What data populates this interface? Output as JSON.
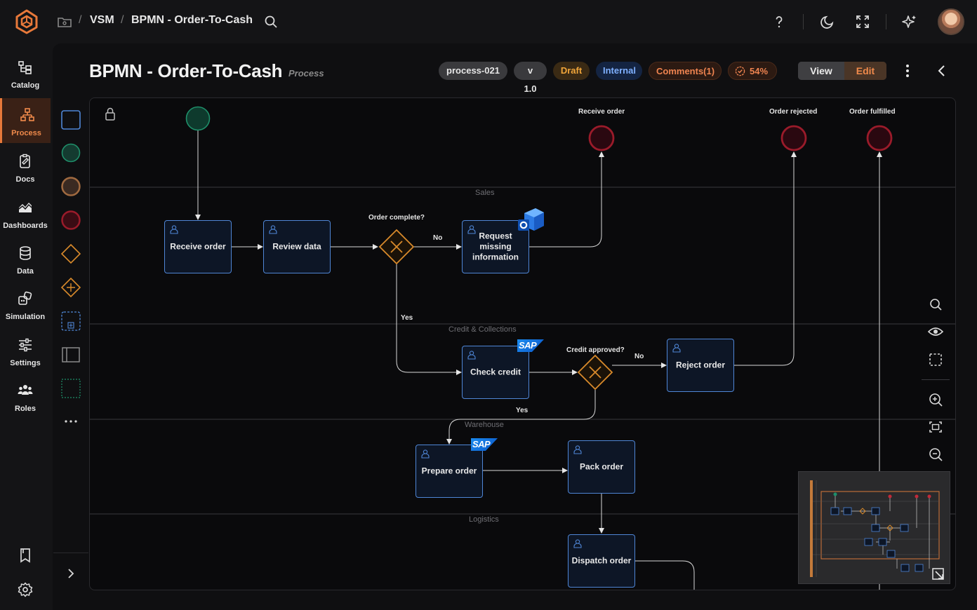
{
  "breadcrumb": {
    "root": "VSM",
    "current": "BPMN - Order-To-Cash"
  },
  "nav": [
    {
      "label": "Catalog",
      "icon": "catalog-icon"
    },
    {
      "label": "Process",
      "icon": "process-icon",
      "active": true
    },
    {
      "label": "Docs",
      "icon": "docs-icon"
    },
    {
      "label": "Dashboards",
      "icon": "dashboards-icon"
    },
    {
      "label": "Data",
      "icon": "data-icon"
    },
    {
      "label": "Simulation",
      "icon": "simulation-icon"
    },
    {
      "label": "Settings",
      "icon": "settings-icon"
    },
    {
      "label": "Roles",
      "icon": "roles-icon"
    }
  ],
  "header": {
    "title": "BPMN - Order-To-Cash",
    "subtitle": "Process",
    "process_id": "process-021",
    "version": "v 1.0",
    "status": "Draft",
    "visibility": "Internal",
    "comments": "Comments(1)",
    "progress": "54%",
    "view_label": "View",
    "edit_label": "Edit"
  },
  "colors": {
    "accent": "#e8793a",
    "task_border": "#4f86d6",
    "gateway": "#d98a2b",
    "end_event": "#9a1b2a",
    "start_event": "#1f8f6a"
  },
  "diagram": {
    "lanes": [
      "Sales",
      "Credit & Collections",
      "Warehouse",
      "Logistics"
    ],
    "end_events": [
      "Receive order",
      "Order rejected",
      "Order fulfilled"
    ],
    "tasks": {
      "receive_order": "Receive order",
      "review_data": "Review data",
      "request_missing": "Request missing information",
      "check_credit": "Check credit",
      "reject_order": "Reject order",
      "prepare_order": "Prepare order",
      "pack_order": "Pack order",
      "dispatch_order": "Dispatch order"
    },
    "gateways": {
      "order_complete": "Order complete?",
      "credit_approved": "Credit approved?"
    },
    "flow_labels": {
      "no1": "No",
      "yes1": "Yes",
      "no2": "No",
      "yes2": "Yes"
    },
    "integrations": {
      "sap": "SAP"
    }
  }
}
